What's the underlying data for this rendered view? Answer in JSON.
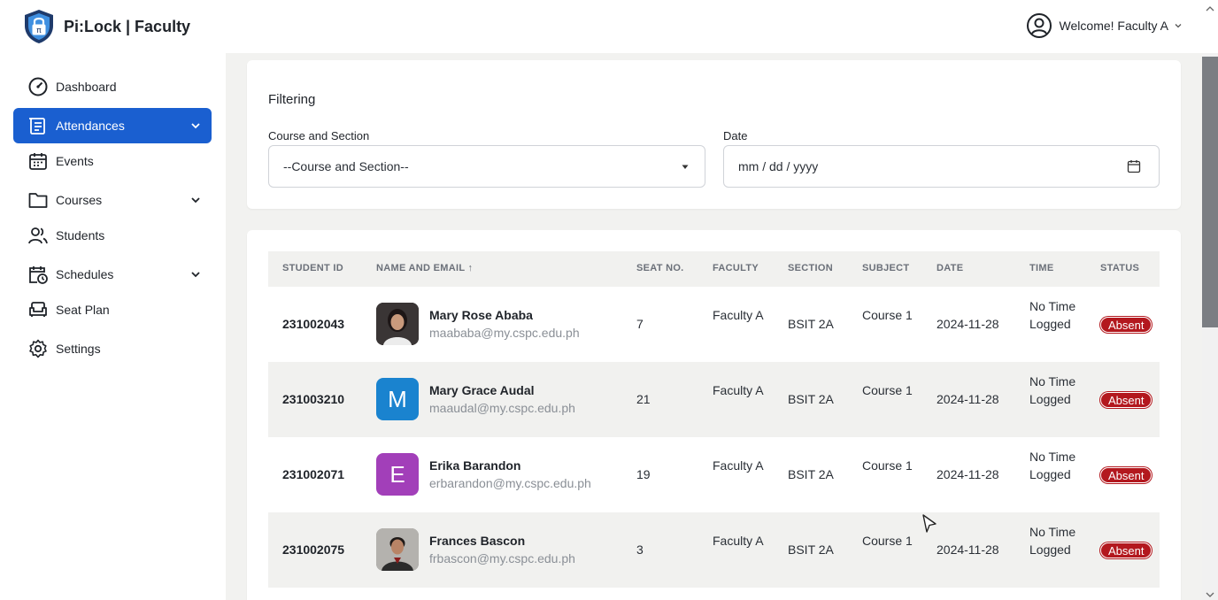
{
  "brand": {
    "name": "Pi:Lock | Faculty"
  },
  "user": {
    "welcome": "Welcome! Faculty A"
  },
  "sidebar": {
    "items": [
      {
        "label": "Dashboard"
      },
      {
        "label": "Attendances"
      },
      {
        "label": "Events"
      },
      {
        "label": "Courses"
      },
      {
        "label": "Students"
      },
      {
        "label": "Schedules"
      },
      {
        "label": "Seat Plan"
      },
      {
        "label": "Settings"
      }
    ]
  },
  "filter": {
    "title": "Filtering",
    "course_label": "Course and Section",
    "course_value": "--Course and Section--",
    "date_label": "Date",
    "date_placeholder": "mm / dd / yyyy"
  },
  "table": {
    "headers": [
      "STUDENT ID",
      "NAME AND EMAIL ↑",
      "SEAT NO.",
      "FACULTY",
      "SECTION",
      "SUBJECT",
      "DATE",
      "TIME",
      "STATUS"
    ],
    "rows": [
      {
        "id": "231002043",
        "name": "Mary Rose Ababa",
        "email": "maababa@my.cspc.edu.ph",
        "seat": "7",
        "faculty": "Faculty A",
        "section": "BSIT 2A",
        "subject": "Course 1",
        "date": "2024-11-28",
        "time": "No Time Logged",
        "status": "Absent",
        "avatar_type": "photo",
        "avatar_letter": ""
      },
      {
        "id": "231003210",
        "name": "Mary Grace Audal",
        "email": "maaudal@my.cspc.edu.ph",
        "seat": "21",
        "faculty": "Faculty A",
        "section": "BSIT 2A",
        "subject": "Course 1",
        "date": "2024-11-28",
        "time": "No Time Logged",
        "status": "Absent",
        "avatar_type": "letter",
        "avatar_letter": "M"
      },
      {
        "id": "231002071",
        "name": "Erika Barandon",
        "email": "erbarandon@my.cspc.edu.ph",
        "seat": "19",
        "faculty": "Faculty A",
        "section": "BSIT 2A",
        "subject": "Course 1",
        "date": "2024-11-28",
        "time": "No Time Logged",
        "status": "Absent",
        "avatar_type": "letter",
        "avatar_letter": "E"
      },
      {
        "id": "231002075",
        "name": "Frances Bascon",
        "email": "frbascon@my.cspc.edu.ph",
        "seat": "3",
        "faculty": "Faculty A",
        "section": "BSIT 2A",
        "subject": "Course 1",
        "date": "2024-11-28",
        "time": "No Time Logged",
        "status": "Absent",
        "avatar_type": "photo",
        "avatar_letter": ""
      }
    ]
  },
  "colors": {
    "accent": "#1a5fd0",
    "absent": "#b3181e",
    "avatar_m": "#1a83cf",
    "avatar_e": "#a23fb9"
  }
}
